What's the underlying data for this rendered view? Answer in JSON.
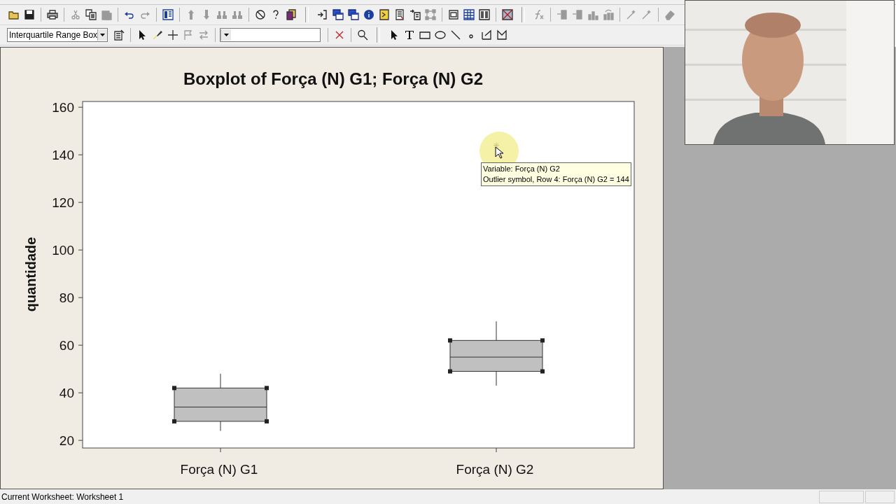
{
  "toolbars": [
    {
      "items": [
        {
          "kind": "open",
          "disabled": false
        },
        {
          "kind": "save",
          "disabled": false
        },
        {
          "kind": "sep"
        },
        {
          "kind": "print",
          "disabled": false
        },
        {
          "kind": "sep"
        },
        {
          "kind": "cut",
          "disabled": true
        },
        {
          "kind": "copy",
          "disabled": false
        },
        {
          "kind": "paste",
          "disabled": true
        },
        {
          "kind": "sep"
        },
        {
          "kind": "undo",
          "disabled": false
        },
        {
          "kind": "redo",
          "disabled": true
        },
        {
          "kind": "sep"
        },
        {
          "kind": "window",
          "disabled": false
        },
        {
          "kind": "sep"
        },
        {
          "kind": "up",
          "disabled": true
        },
        {
          "kind": "down",
          "disabled": true
        },
        {
          "kind": "find",
          "disabled": true
        },
        {
          "kind": "replace",
          "disabled": true
        },
        {
          "kind": "sep"
        },
        {
          "kind": "cancel",
          "disabled": false
        },
        {
          "kind": "help",
          "disabled": false
        },
        {
          "kind": "project",
          "disabled": false
        },
        {
          "kind": "break"
        },
        {
          "kind": "append",
          "disabled": false
        },
        {
          "kind": "tile",
          "disabled": false
        },
        {
          "kind": "tile",
          "disabled": false
        },
        {
          "kind": "info",
          "disabled": false
        },
        {
          "kind": "exec",
          "disabled": false
        },
        {
          "kind": "report",
          "disabled": false
        },
        {
          "kind": "insert",
          "disabled": false
        },
        {
          "kind": "layout",
          "disabled": true
        },
        {
          "kind": "sep"
        },
        {
          "kind": "scroll",
          "disabled": false
        },
        {
          "kind": "grid",
          "disabled": false
        },
        {
          "kind": "table",
          "disabled": false
        },
        {
          "kind": "sep"
        },
        {
          "kind": "nogrid",
          "disabled": false
        },
        {
          "kind": "break"
        },
        {
          "kind": "fx",
          "disabled": true
        },
        {
          "kind": "sep"
        },
        {
          "kind": "rowin",
          "disabled": true
        },
        {
          "kind": "rowin",
          "disabled": true
        },
        {
          "kind": "bars",
          "disabled": true
        },
        {
          "kind": "barsrot",
          "disabled": true
        },
        {
          "kind": "sep"
        },
        {
          "kind": "wand",
          "disabled": true
        },
        {
          "kind": "wand",
          "disabled": true
        },
        {
          "kind": "sep"
        },
        {
          "kind": "eraser",
          "disabled": true
        }
      ]
    },
    {
      "items": [
        {
          "kind": "dropdown",
          "value": "Interquartile Range Box"
        },
        {
          "kind": "props",
          "disabled": false
        },
        {
          "kind": "sep"
        },
        {
          "kind": "pointer",
          "disabled": false
        },
        {
          "kind": "brush",
          "disabled": false
        },
        {
          "kind": "crosshair",
          "disabled": false
        },
        {
          "kind": "flag",
          "disabled": true
        },
        {
          "kind": "swap",
          "disabled": true
        },
        {
          "kind": "sep"
        },
        {
          "kind": "dropdown"
        },
        {
          "kind": "sep"
        },
        {
          "kind": "delete",
          "disabled": false
        },
        {
          "kind": "sep"
        },
        {
          "kind": "zoom",
          "disabled": false
        },
        {
          "kind": "break"
        },
        {
          "kind": "pointer",
          "disabled": false
        },
        {
          "kind": "text",
          "disabled": false
        },
        {
          "kind": "rect",
          "disabled": false
        },
        {
          "kind": "ellipse",
          "disabled": false
        },
        {
          "kind": "line",
          "disabled": false
        },
        {
          "kind": "dot",
          "disabled": false
        },
        {
          "kind": "polyline",
          "disabled": false
        },
        {
          "kind": "polygon",
          "disabled": false
        }
      ]
    }
  ],
  "graph": {
    "chart_data": {
      "type": "box",
      "title": "Boxplot of Força (N) G1; Força (N) G2",
      "ylabel": "quantidade",
      "categories": [
        "Força (N) G1",
        "Força (N) G2"
      ],
      "ylim": [
        16.8,
        162.4
      ],
      "yticks": [
        20,
        40,
        60,
        80,
        100,
        120,
        140,
        160
      ]
    },
    "boxes": [
      {
        "selected": true
      },
      {
        "selected": true
      }
    ],
    "tooltip": {
      "lines": [
        "Variable: Força (N) G2",
        "Outlier symbol, Row 4: Força (N) G2 = 144"
      ]
    }
  },
  "status_bar": {
    "text": "Current Worksheet: Worksheet 1"
  }
}
